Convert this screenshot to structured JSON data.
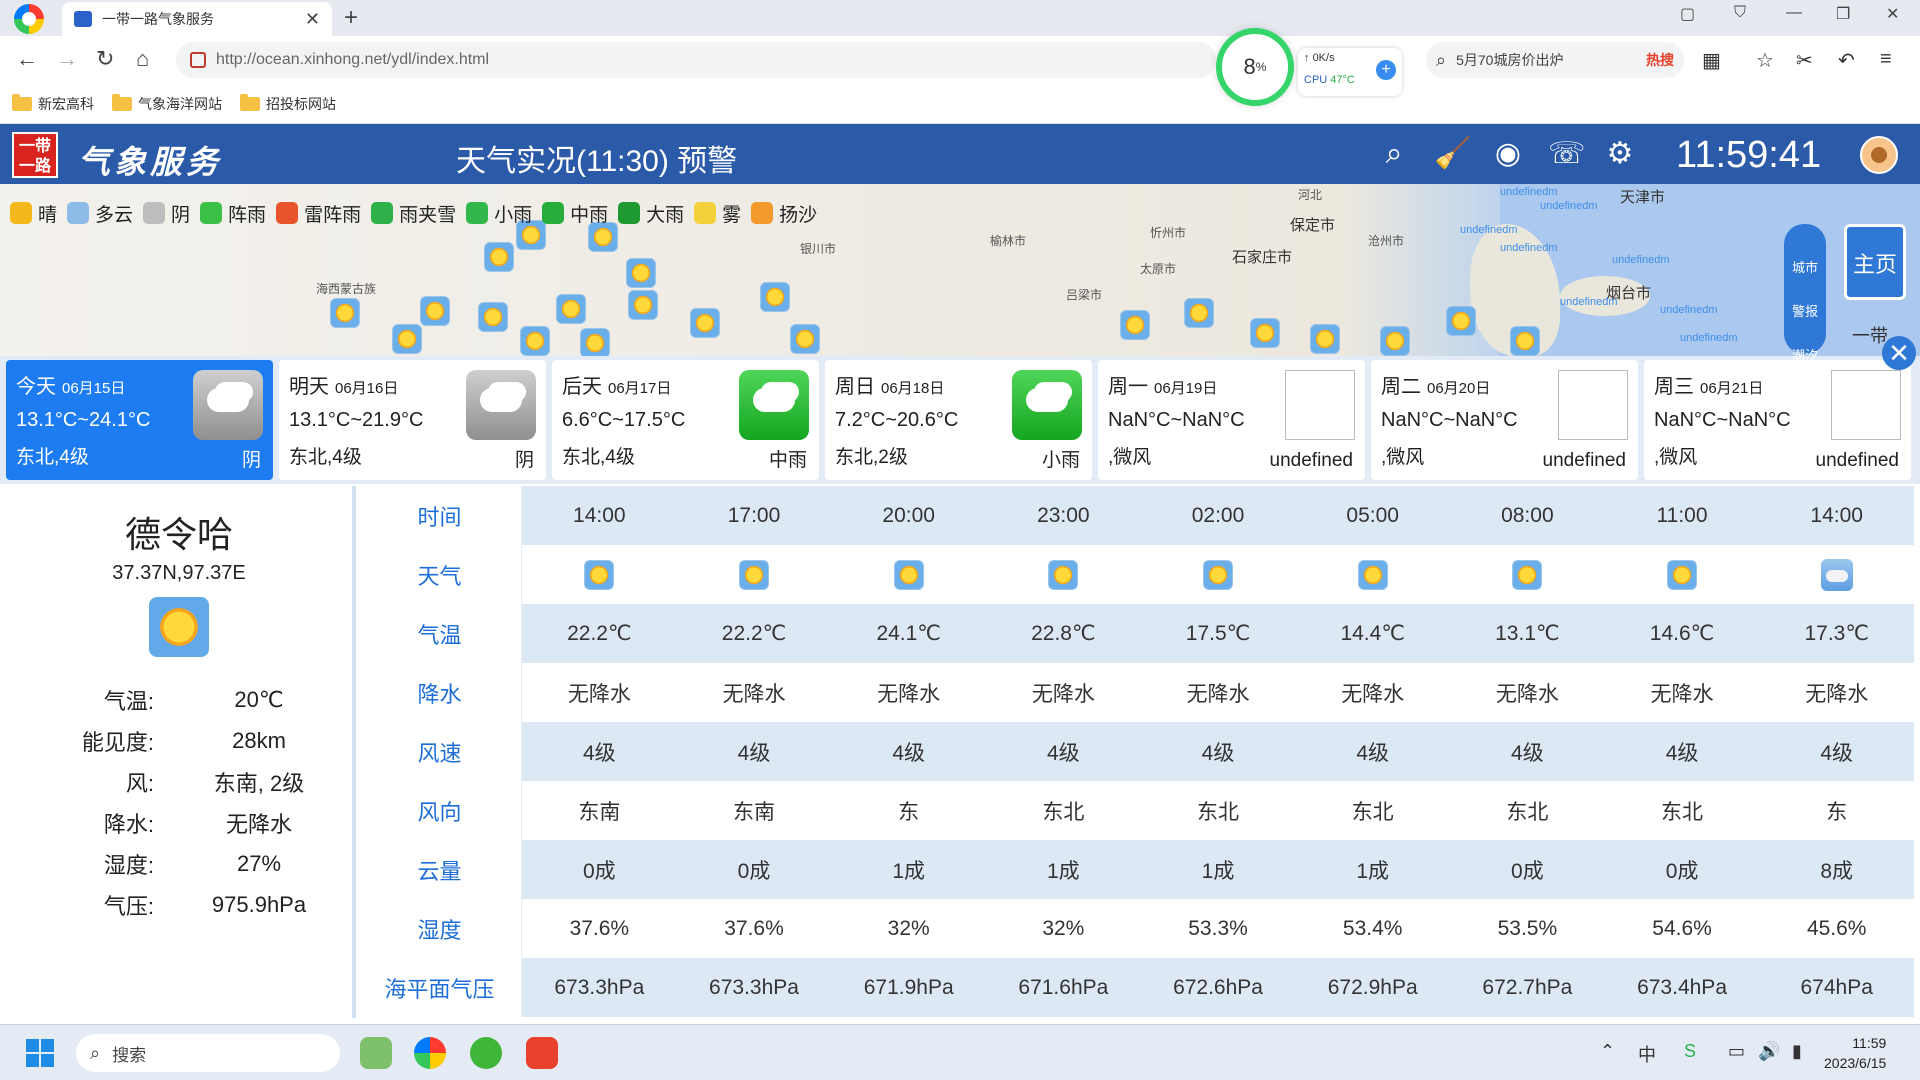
{
  "browser": {
    "tab_title": "一带一路气象服务",
    "url": "http://ocean.xinhong.net/ydl/index.html",
    "perf_value": "8",
    "perf_unit": "%",
    "net_speed": "0K/s",
    "cpu_label": "CPU",
    "cpu_temp": "47°C",
    "search_text": "5月70城房价出炉",
    "hot_label": "热搜",
    "bookmarks": [
      "新宏高科",
      "气象海洋网站",
      "招投标网站"
    ]
  },
  "header": {
    "logo_text": "一带一路",
    "brand": "气象服务",
    "title": "天气实况(11:30) 预警",
    "clock": "11:59:41"
  },
  "legend": [
    {
      "label": "晴",
      "color": "#f4b71c"
    },
    {
      "label": "多云",
      "color": "#8fbbe8"
    },
    {
      "label": "阴",
      "color": "#bdbdbd"
    },
    {
      "label": "阵雨",
      "color": "#3bbf47"
    },
    {
      "label": "雷阵雨",
      "color": "#e8552c"
    },
    {
      "label": "雨夹雪",
      "color": "#2fb14a"
    },
    {
      "label": "小雨",
      "color": "#32b84a"
    },
    {
      "label": "中雨",
      "color": "#26ad3c"
    },
    {
      "label": "大雨",
      "color": "#1f9a33"
    },
    {
      "label": "雾",
      "color": "#f3d13a"
    },
    {
      "label": "扬沙",
      "color": "#f29a2c"
    }
  ],
  "map": {
    "labels": [
      "保定市",
      "石家庄市",
      "太原市",
      "忻州市",
      "吕梁市",
      "榆林市",
      "银川市",
      "沧州市",
      "天津市",
      "烟台市",
      "海西蒙古族",
      "河北"
    ],
    "undefined_label": "undefinedm",
    "side_tabs": [
      "城市",
      "警报",
      "潮汐"
    ],
    "home_button": "主页",
    "side_text": "一带"
  },
  "days": [
    {
      "name": "今天",
      "date": "06月15日",
      "temp": "13.1°C~24.1°C",
      "wind": "东北,4级",
      "weather": "阴",
      "icon": "cloudy"
    },
    {
      "name": "明天",
      "date": "06月16日",
      "temp": "13.1°C~21.9°C",
      "wind": "东北,4级",
      "weather": "阴",
      "icon": "cloudy"
    },
    {
      "name": "后天",
      "date": "06月17日",
      "temp": "6.6°C~17.5°C",
      "wind": "东北,4级",
      "weather": "中雨",
      "icon": "rain"
    },
    {
      "name": "周日",
      "date": "06月18日",
      "temp": "7.2°C~20.6°C",
      "wind": "东北,2级",
      "weather": "小雨",
      "icon": "rain"
    },
    {
      "name": "周一",
      "date": "06月19日",
      "temp": "NaN°C~NaN°C",
      "wind": ",微风",
      "weather": "undefined",
      "icon": "missing"
    },
    {
      "name": "周二",
      "date": "06月20日",
      "temp": "NaN°C~NaN°C",
      "wind": ",微风",
      "weather": "undefined",
      "icon": "missing"
    },
    {
      "name": "周三",
      "date": "06月21日",
      "temp": "NaN°C~NaN°C",
      "wind": ",微风",
      "weather": "undefined",
      "icon": "missing"
    }
  ],
  "city": {
    "name": "德令哈",
    "coord": "37.37N,97.37E",
    "rows": [
      {
        "k": "气温:",
        "v": "20℃"
      },
      {
        "k": "能见度:",
        "v": "28km"
      },
      {
        "k": "风:",
        "v": "东南, 2级"
      },
      {
        "k": "降水:",
        "v": "无降水"
      },
      {
        "k": "湿度:",
        "v": "27%"
      },
      {
        "k": "气压:",
        "v": "975.9hPa"
      }
    ]
  },
  "hourly": {
    "rows": [
      {
        "label": "时间",
        "values": [
          "14:00",
          "17:00",
          "20:00",
          "23:00",
          "02:00",
          "05:00",
          "08:00",
          "11:00",
          "14:00"
        ]
      },
      {
        "label": "天气",
        "icons": [
          "sun-icon",
          "sun-icon",
          "sun-icon",
          "sun-icon",
          "sun-icon",
          "sun-icon",
          "sun-icon",
          "sun-icon",
          "cloud-icon"
        ]
      },
      {
        "label": "气温",
        "values": [
          "22.2℃",
          "22.2℃",
          "24.1℃",
          "22.8℃",
          "17.5℃",
          "14.4℃",
          "13.1℃",
          "14.6℃",
          "17.3℃"
        ]
      },
      {
        "label": "降水",
        "values": [
          "无降水",
          "无降水",
          "无降水",
          "无降水",
          "无降水",
          "无降水",
          "无降水",
          "无降水",
          "无降水"
        ]
      },
      {
        "label": "风速",
        "values": [
          "4级",
          "4级",
          "4级",
          "4级",
          "4级",
          "4级",
          "4级",
          "4级",
          "4级"
        ]
      },
      {
        "label": "风向",
        "values": [
          "东南",
          "东南",
          "东",
          "东北",
          "东北",
          "东北",
          "东北",
          "东北",
          "东"
        ]
      },
      {
        "label": "云量",
        "values": [
          "0成",
          "0成",
          "1成",
          "1成",
          "1成",
          "1成",
          "0成",
          "0成",
          "8成"
        ]
      },
      {
        "label": "湿度",
        "values": [
          "37.6%",
          "37.6%",
          "32%",
          "32%",
          "53.3%",
          "53.4%",
          "53.5%",
          "54.6%",
          "45.6%"
        ]
      },
      {
        "label": "海平面气压",
        "values": [
          "673.3hPa",
          "673.3hPa",
          "671.9hPa",
          "671.6hPa",
          "672.6hPa",
          "672.9hPa",
          "672.7hPa",
          "673.4hPa",
          "674hPa"
        ]
      }
    ]
  },
  "taskbar": {
    "search_placeholder": "搜索",
    "time": "11:59",
    "date": "2023/6/15"
  }
}
